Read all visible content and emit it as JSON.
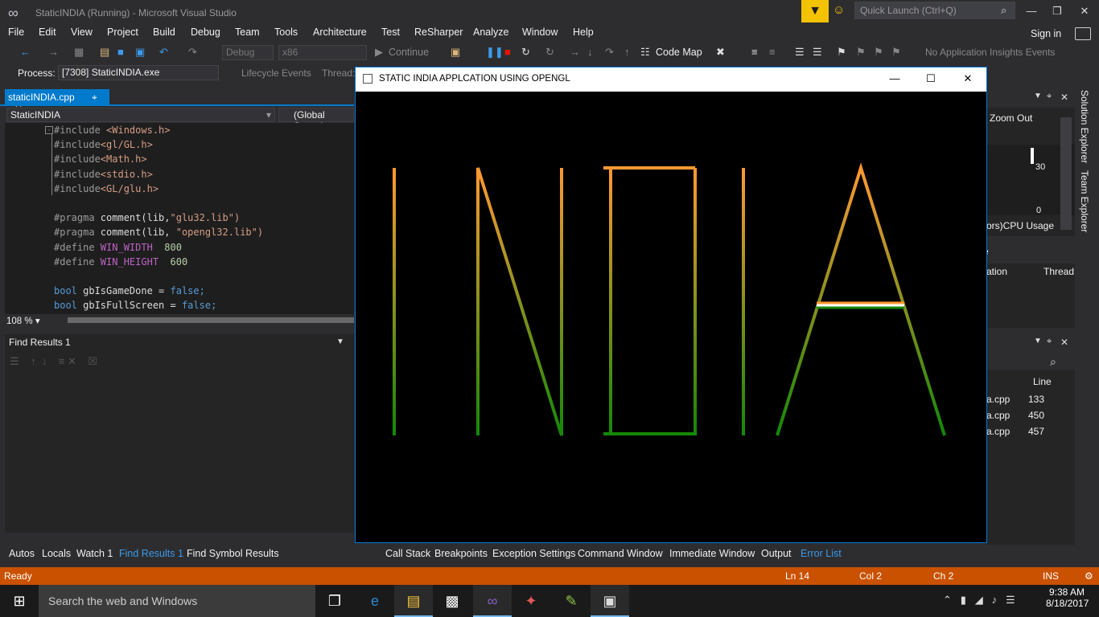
{
  "window_title": "StaticINDIA (Running) - Microsoft Visual Studio",
  "quick_launch_placeholder": "Quick Launch (Ctrl+Q)",
  "menu": [
    "File",
    "Edit",
    "View",
    "Project",
    "Build",
    "Debug",
    "Team",
    "Tools",
    "Architecture",
    "Test",
    "ReSharper",
    "Analyze",
    "Window",
    "Help"
  ],
  "sign_in": "Sign in",
  "toolbar": {
    "config": "Debug",
    "platform": "x86",
    "continue": "Continue",
    "code_map": "Code Map",
    "ai_events": "No Application Insights Events"
  },
  "process": {
    "label": "Process:",
    "value": "[7308] StaticINDIA.exe",
    "lifecycle": "Lifecycle Events",
    "thread": "Thread:"
  },
  "editor": {
    "tab": "staticINDIA.cpp",
    "nav_left": "StaticINDIA",
    "nav_right": "(Global Scope)",
    "zoom": "108 %",
    "lines": [
      {
        "a": "#include ",
        "b": "<Windows.h>",
        "c": ""
      },
      {
        "a": "#include",
        "b": "<gl/GL.h>",
        "c": ""
      },
      {
        "a": "#include",
        "b": "<Math.h>",
        "c": ""
      },
      {
        "a": "#include",
        "b": "<stdio.h>",
        "c": ""
      },
      {
        "a": "#include",
        "b": "<GL/glu.h>",
        "c": ""
      },
      {
        "a": "",
        "b": "",
        "c": ""
      },
      {
        "a": "#pragma ",
        "b": "comment(lib,",
        "c": "\"glu32.lib\")"
      },
      {
        "a": "#pragma ",
        "b": "comment(lib, ",
        "c": "\"opengl32.lib\")"
      },
      {
        "a": "#define ",
        "b": "WIN_WIDTH",
        "c": "  800"
      },
      {
        "a": "#define ",
        "b": "WIN_HEIGHT",
        "c": "  600"
      },
      {
        "a": "",
        "b": "",
        "c": ""
      },
      {
        "a": "bool ",
        "b": "gbIsGameDone = ",
        "c": "false;"
      },
      {
        "a": "bool ",
        "b": "gbIsFullScreen = ",
        "c": "false;"
      }
    ]
  },
  "find_results": {
    "title": "Find Results 1"
  },
  "bottom_tabs": [
    "Autos",
    "Locals",
    "Watch 1",
    "Find Results 1",
    "Find Symbol Results"
  ],
  "debug_tabs": [
    "Call Stack",
    "Breakpoints",
    "Exception Settings",
    "Command Window",
    "Immediate Window",
    "Output",
    "Error List"
  ],
  "right_panel": {
    "zoom_out": "Zoom Out",
    "axis_top": "30",
    "axis_bottom": "0",
    "cpu_usage": "ors)CPU Usage",
    "col_ation": "ation",
    "col_thread": "Thread",
    "col_e": "e",
    "line_header": "Line",
    "rows": [
      {
        "file": "a.cpp",
        "line": "133"
      },
      {
        "file": "a.cpp",
        "line": "450"
      },
      {
        "file": "a.cpp",
        "line": "457"
      }
    ]
  },
  "side_tabs": [
    "Solution Explorer",
    "Team Explorer"
  ],
  "status": {
    "state": "Ready",
    "ln": "Ln 14",
    "col": "Col 2",
    "ch": "Ch 2",
    "ins": "INS"
  },
  "gl_window": {
    "title": "STATIC INDIA APPLCATION USING OPENGL",
    "colors": {
      "saffron": "#ff9933",
      "white": "#ffffff",
      "green": "#138808"
    }
  },
  "taskbar": {
    "search_placeholder": "Search the web and Windows",
    "time": "9:38 AM",
    "date": "8/18/2017"
  }
}
